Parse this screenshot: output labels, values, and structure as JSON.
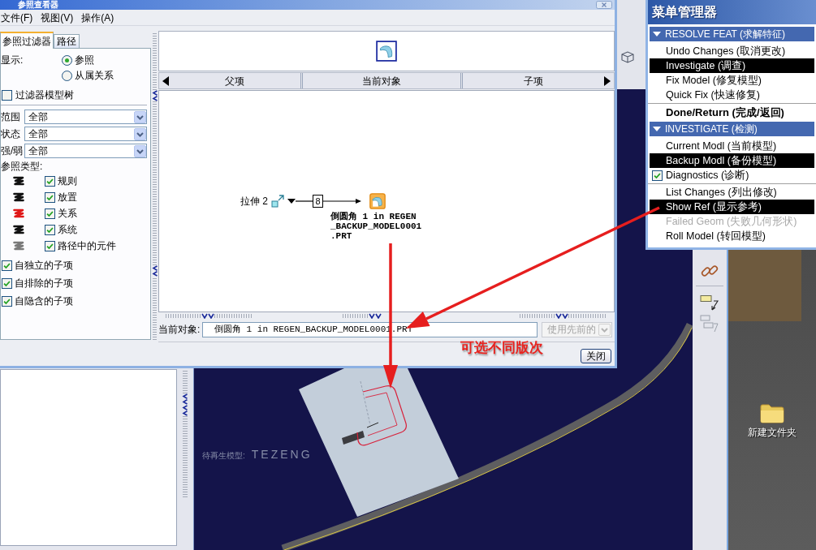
{
  "dialog": {
    "title": "参照查看器",
    "menus": [
      "文件(F)",
      "视图(V)",
      "操作(A)"
    ],
    "tabs": [
      {
        "label": "参照过滤器",
        "selected": true
      },
      {
        "label": "路径",
        "selected": false
      }
    ],
    "filter": {
      "display_label": "显示:",
      "display_options": [
        {
          "label": "参照",
          "selected": true
        },
        {
          "label": "从属关系",
          "selected": false
        }
      ],
      "model_tree": {
        "label": "过滤器模型树",
        "checked": false
      },
      "dropdowns": [
        {
          "label": "范围",
          "value": "全部"
        },
        {
          "label": "状态",
          "value": "全部"
        },
        {
          "label": "强/弱",
          "value": "全部"
        }
      ],
      "types_label": "参照类型:",
      "types": [
        {
          "label": "规则",
          "checked": true,
          "color": "#111111"
        },
        {
          "label": "放置",
          "checked": true,
          "color": "#111111"
        },
        {
          "label": "关系",
          "checked": true,
          "color": "#e01818"
        },
        {
          "label": "系统",
          "checked": true,
          "color": "#111111"
        },
        {
          "label": "路径中的元件",
          "checked": true,
          "color": "#7a7a7a"
        }
      ],
      "children": [
        {
          "label": "自独立的子项",
          "checked": true
        },
        {
          "label": "自排除的子项",
          "checked": true
        },
        {
          "label": "自隐含的子项",
          "checked": true
        }
      ]
    },
    "columns": [
      "父项",
      "当前对象",
      "子项"
    ],
    "graph": {
      "parent": "拉伸 2",
      "link": "8",
      "current": [
        "倒圆角 1 in REGEN",
        "_BACKUP_MODEL0001",
        ".PRT"
      ]
    },
    "current_object": {
      "label": "当前对象:",
      "value": "倒圆角 1 in REGEN_BACKUP_MODEL0001.PRT"
    },
    "version": {
      "value": "使用先前的",
      "disabled": true
    },
    "buttons": [
      "关闭"
    ]
  },
  "annotation": {
    "note": "可选不同版次"
  },
  "menu_manager": {
    "title": "菜单管理器",
    "sections": [
      {
        "title": "RESOLVE FEAT (求解特征)",
        "expanded": true,
        "groups": [
          {
            "items": [
              {
                "label": "Undo Changes (取消更改)",
                "kind": "option",
                "selected": false,
                "disabled": false
              },
              {
                "label": "Investigate (调查)",
                "kind": "option",
                "selected": true,
                "disabled": false
              },
              {
                "label": "Fix Model (修复模型)",
                "kind": "option",
                "selected": false,
                "disabled": false
              },
              {
                "label": "Quick Fix (快速修复)",
                "kind": "option",
                "selected": false,
                "disabled": false
              }
            ]
          },
          {
            "items": [
              {
                "label": "Done/Return (完成/返回)",
                "kind": "action",
                "selected": false,
                "disabled": false
              }
            ]
          }
        ]
      },
      {
        "title": "INVESTIGATE (检测)",
        "expanded": true,
        "groups": [
          {
            "items": [
              {
                "label": "Current Modl (当前模型)",
                "kind": "option",
                "selected": false,
                "disabled": false
              },
              {
                "label": "Backup Modl (备份模型)",
                "kind": "option",
                "selected": true,
                "disabled": false
              },
              {
                "label": "Diagnostics (诊断)",
                "kind": "toggle",
                "checked": true,
                "selected": false,
                "disabled": false
              }
            ]
          },
          {
            "items": [
              {
                "label": "List Changes (列出修改)",
                "kind": "option",
                "selected": false,
                "disabled": false
              },
              {
                "label": "Show Ref (显示参考)",
                "kind": "option",
                "selected": true,
                "disabled": false
              },
              {
                "label": "Failed Geom (失败几何形状)",
                "kind": "option",
                "selected": false,
                "disabled": true
              },
              {
                "label": "Roll Model (转回模型)",
                "kind": "option",
                "selected": false,
                "disabled": false
              }
            ]
          }
        ]
      }
    ]
  },
  "viewport": {
    "label": "待再生模型:",
    "model": "TEZENG"
  },
  "desktop": {
    "folder": "新建文件夹"
  }
}
